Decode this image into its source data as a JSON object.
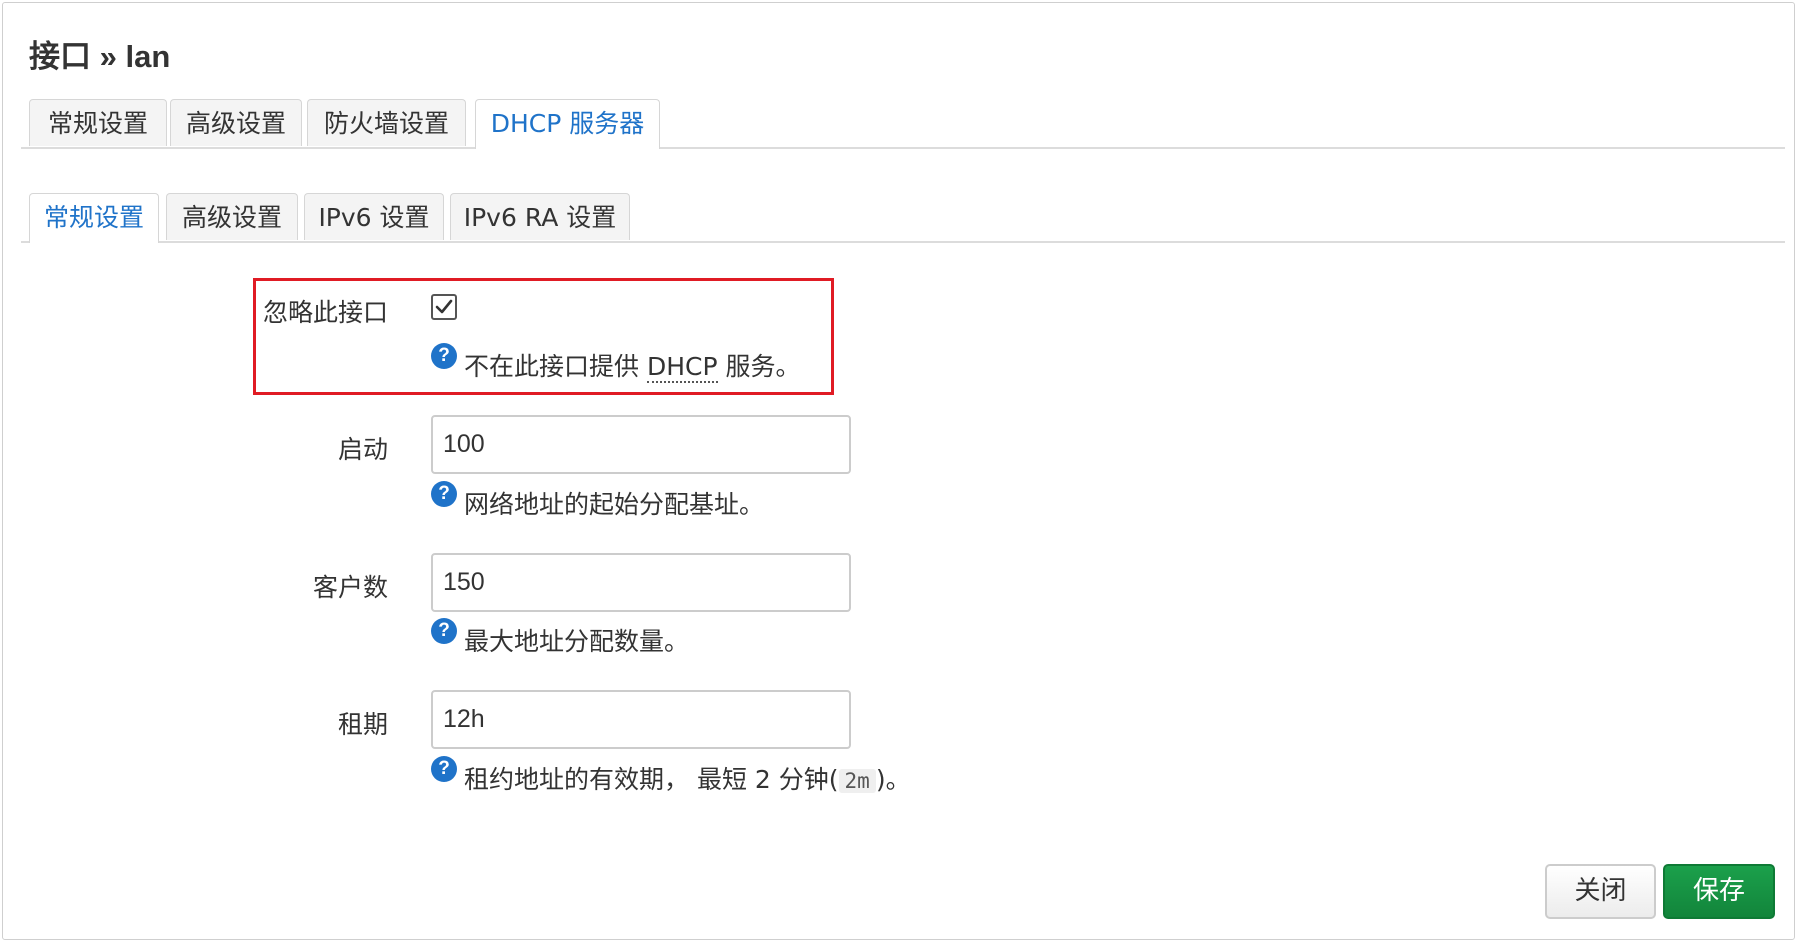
{
  "title": "接口 » lan",
  "top_tabs": [
    {
      "label": "常规设置"
    },
    {
      "label": "高级设置"
    },
    {
      "label": "防火墙设置"
    },
    {
      "label": "DHCP 服务器"
    }
  ],
  "sub_tabs": [
    {
      "label": "常规设置"
    },
    {
      "label": "高级设置"
    },
    {
      "label": "IPv6 设置"
    },
    {
      "label": "IPv6 RA 设置"
    }
  ],
  "ignore": {
    "label": "忽略此接口",
    "checked": true,
    "help_prefix": "不在此接口提供 ",
    "help_abbr": "DHCP",
    "help_suffix": " 服务。"
  },
  "start": {
    "label": "启动",
    "value": "100",
    "help": "网络地址的起始分配基址。"
  },
  "limit": {
    "label": "客户数",
    "value": "150",
    "help": "最大地址分配数量。"
  },
  "leasetime": {
    "label": "租期",
    "value": "12h",
    "help_prefix": "租约地址的有效期， 最短 2 分钟(",
    "help_code": "2m",
    "help_suffix": ")。"
  },
  "help_icon_glyph": "?",
  "buttons": {
    "close": "关闭",
    "save": "保存"
  },
  "colors": {
    "accent": "#1f73c9",
    "highlight": "#e01b24",
    "save": "#1ba04b"
  }
}
